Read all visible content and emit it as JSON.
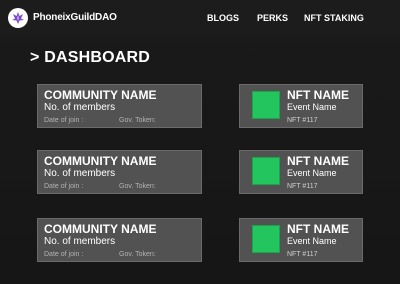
{
  "navbar": {
    "brand": "PhoneixGuildDAO",
    "links": [
      "BLOGS",
      "PERKS",
      "NFT STAKING"
    ]
  },
  "page": {
    "title": "> DASHBOARD"
  },
  "communities": [
    {
      "name": "COMMUNITY NAME",
      "members": "No. of members",
      "join": "Date of join :",
      "token": "Gov. Token:"
    },
    {
      "name": "COMMUNITY NAME",
      "members": "No. of members",
      "join": "Date of join :",
      "token": "Gov. Token:"
    },
    {
      "name": "COMMUNITY NAME",
      "members": "No. of members",
      "join": "Date of join :",
      "token": "Gov. Token:"
    }
  ],
  "nfts": [
    {
      "name": "NFT NAME",
      "event": "Event Name",
      "id": "NFT #117"
    },
    {
      "name": "NFT NAME",
      "event": "Event Name",
      "id": "NFT #117"
    },
    {
      "name": "NFT NAME",
      "event": "Event Name",
      "id": "NFT #117"
    }
  ],
  "colors": {
    "background": "#1a1a1a",
    "card": "#525252",
    "nft_thumbnail": "#22c55e"
  }
}
